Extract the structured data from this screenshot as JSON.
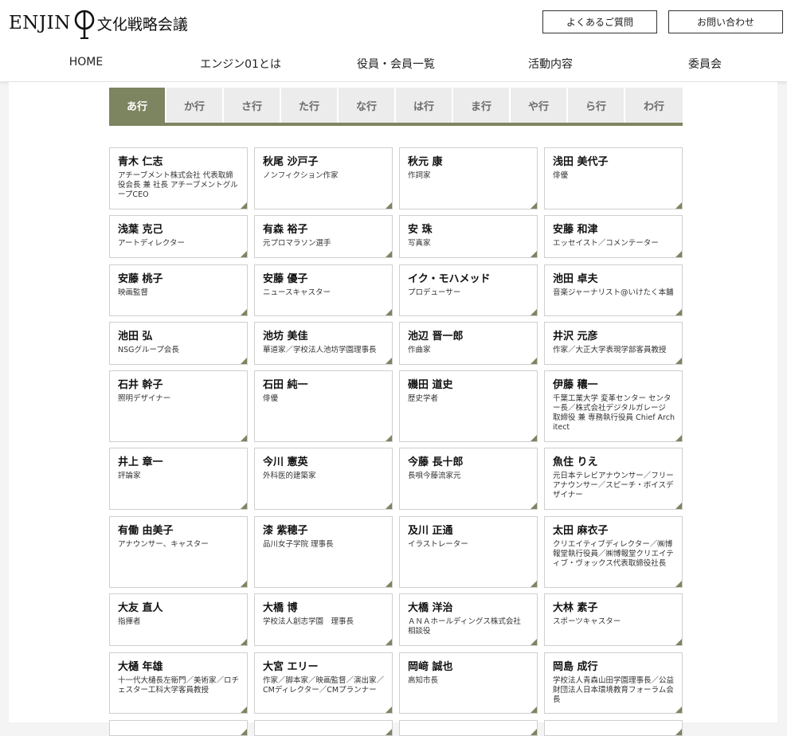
{
  "header": {
    "logo_text": "ENJIN",
    "logo_jp": "文化戦略会議",
    "faq_label": "よくあるご質問",
    "contact_label": "お問い合わせ"
  },
  "nav": [
    "HOME",
    "エンジン01とは",
    "役員・会員一覧",
    "活動内容",
    "委員会"
  ],
  "tabs": [
    "あ行",
    "か行",
    "さ行",
    "た行",
    "な行",
    "は行",
    "ま行",
    "や行",
    "ら行",
    "わ行"
  ],
  "active_tab": "あ行",
  "accent_color": "#7d8460",
  "members": [
    {
      "name": "青木 仁志",
      "role": "アチーブメント株式会社 代表取締役会長 兼 社長 アチーブメントグループCEO"
    },
    {
      "name": "秋尾 沙戸子",
      "role": "ノンフィクション作家"
    },
    {
      "name": "秋元 康",
      "role": "作詞家"
    },
    {
      "name": "浅田 美代子",
      "role": "俳優"
    },
    {
      "name": "浅葉 克己",
      "role": "アートディレクター"
    },
    {
      "name": "有森 裕子",
      "role": "元プロマラソン選手"
    },
    {
      "name": "安 珠",
      "role": "写真家"
    },
    {
      "name": "安藤 和津",
      "role": "エッセイスト／コメンテーター"
    },
    {
      "name": "安藤 桃子",
      "role": "映画監督"
    },
    {
      "name": "安藤 優子",
      "role": "ニュースキャスター"
    },
    {
      "name": "イク・モハメッド",
      "role": "プロデューサー"
    },
    {
      "name": "池田 卓夫",
      "role": "音楽ジャーナリスト@いけたく本舗"
    },
    {
      "name": "池田 弘",
      "role": "NSGグループ会長"
    },
    {
      "name": "池坊 美佳",
      "role": "華道家／学校法人池坊学園理事長"
    },
    {
      "name": "池辺 晋一郎",
      "role": "作曲家"
    },
    {
      "name": "井沢 元彦",
      "role": "作家／大正大学表現学部客員教授"
    },
    {
      "name": "石井 幹子",
      "role": "照明デザイナー"
    },
    {
      "name": "石田 純一",
      "role": "俳優"
    },
    {
      "name": "磯田 道史",
      "role": "歴史学者"
    },
    {
      "name": "伊藤 穰一",
      "role": "千葉工業大学 変革センター センター長／株式会社デジタルガレージ 取締役 兼 専務執行役員 Chief Architect"
    },
    {
      "name": "井上 章一",
      "role": "評論家"
    },
    {
      "name": "今川 憲英",
      "role": "外科医的建築家"
    },
    {
      "name": "今藤 長十郎",
      "role": "長唄今藤流家元"
    },
    {
      "name": "魚住 りえ",
      "role": "元日本テレビアナウンサー／フリーアナウンサー／スピーチ・ボイスデザイナー"
    },
    {
      "name": "有働 由美子",
      "role": "アナウンサー、キャスター"
    },
    {
      "name": "漆 紫穂子",
      "role": "品川女子学院 理事長"
    },
    {
      "name": "及川 正通",
      "role": "イラストレーター"
    },
    {
      "name": "太田 麻衣子",
      "role": "クリエイティブディレクター／㈱博報堂執行役員／㈱博報堂クリエイティブ・ヴォックス代表取締役社長"
    },
    {
      "name": "大友 直人",
      "role": "指揮者"
    },
    {
      "name": "大橋 博",
      "role": "学校法人創志学園　理事長"
    },
    {
      "name": "大橋 洋治",
      "role": "ＡＮＡホールディングス株式会社 相談役"
    },
    {
      "name": "大林 素子",
      "role": "スポーツキャスター"
    },
    {
      "name": "大樋 年雄",
      "role": "十一代大樋長左衛門／美術家／ロチェスター工科大学客員教授"
    },
    {
      "name": "大宮 エリー",
      "role": "作家／脚本家／映画監督／演出家／CMディレクター／CMプランナー"
    },
    {
      "name": "岡﨑 誠也",
      "role": "高知市長"
    },
    {
      "name": "岡島 成行",
      "role": "学校法人青森山田学園理事長／公益財団法人日本環境教育フォーラム会長"
    }
  ]
}
